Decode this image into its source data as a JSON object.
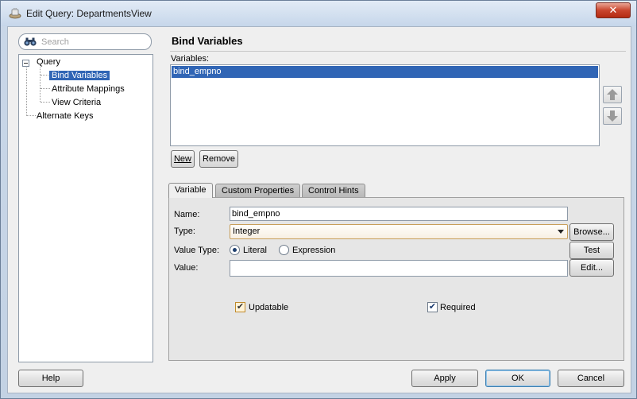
{
  "window": {
    "title": "Edit Query: DepartmentsView",
    "close_glyph": "✕"
  },
  "sidebar": {
    "search_placeholder": "Search",
    "tree": {
      "root": "Query",
      "children": [
        "Bind Variables",
        "Attribute Mappings",
        "View Criteria"
      ],
      "sibling": "Alternate Keys"
    }
  },
  "main": {
    "title": "Bind Variables",
    "variables_label": "Variables:",
    "variables": [
      "bind_empno"
    ],
    "new_button": "New",
    "remove_button": "Remove",
    "move_up_icon": "arrow-up-icon",
    "move_down_icon": "arrow-down-icon"
  },
  "tabs": [
    "Variable",
    "Custom Properties",
    "Control Hints"
  ],
  "variable_tab": {
    "name_label": "Name:",
    "name_value": "bind_empno",
    "type_label": "Type:",
    "type_value": "Integer",
    "browse_button": "Browse...",
    "value_type_label": "Value Type:",
    "literal_label": "Literal",
    "expression_label": "Expression",
    "value_type_selected": "Literal",
    "test_button": "Test",
    "value_label": "Value:",
    "value_value": "",
    "edit_button": "Edit...",
    "updatable_label": "Updatable",
    "updatable_checked": true,
    "required_label": "Required",
    "required_checked": true,
    "check_glyph": "✔"
  },
  "footer": {
    "help_button": "Help",
    "apply_button": "Apply",
    "ok_button": "OK",
    "cancel_button": "Cancel"
  },
  "colors": {
    "selection": "#3065b5",
    "titlebar": "#c6d6ea",
    "close": "#c9452d"
  }
}
